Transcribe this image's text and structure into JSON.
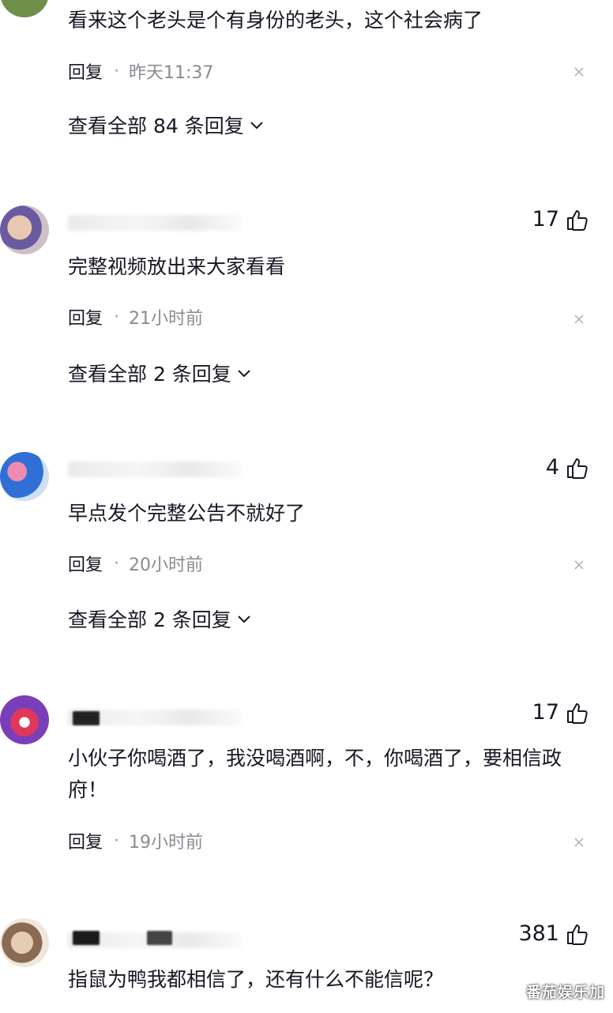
{
  "comments": [
    {
      "text": "看来这个老头是个有身份的老头，这个社会病了",
      "reply_label": "回复",
      "time": "昨天11:37",
      "view_replies": "查看全部 84 条回复"
    },
    {
      "likes": "17",
      "text": "完整视频放出来大家看看",
      "reply_label": "回复",
      "time": "21小时前",
      "view_replies": "查看全部 2 条回复"
    },
    {
      "likes": "4",
      "text": "早点发个完整公告不就好了",
      "reply_label": "回复",
      "time": "20小时前",
      "view_replies": "查看全部 2 条回复"
    },
    {
      "likes": "17",
      "text": "小伙子你喝酒了，我没喝酒啊，不，你喝酒了，要相信政府！",
      "reply_label": "回复",
      "time": "19小时前"
    },
    {
      "likes": "381",
      "text": "指鼠为鸭我都相信了，还有什么不能信呢？"
    }
  ],
  "watermark": "番茄娱乐加",
  "icons": {
    "like": "thumbs-up-icon",
    "dismiss": "close-icon",
    "expand": "chevron-down-icon"
  }
}
